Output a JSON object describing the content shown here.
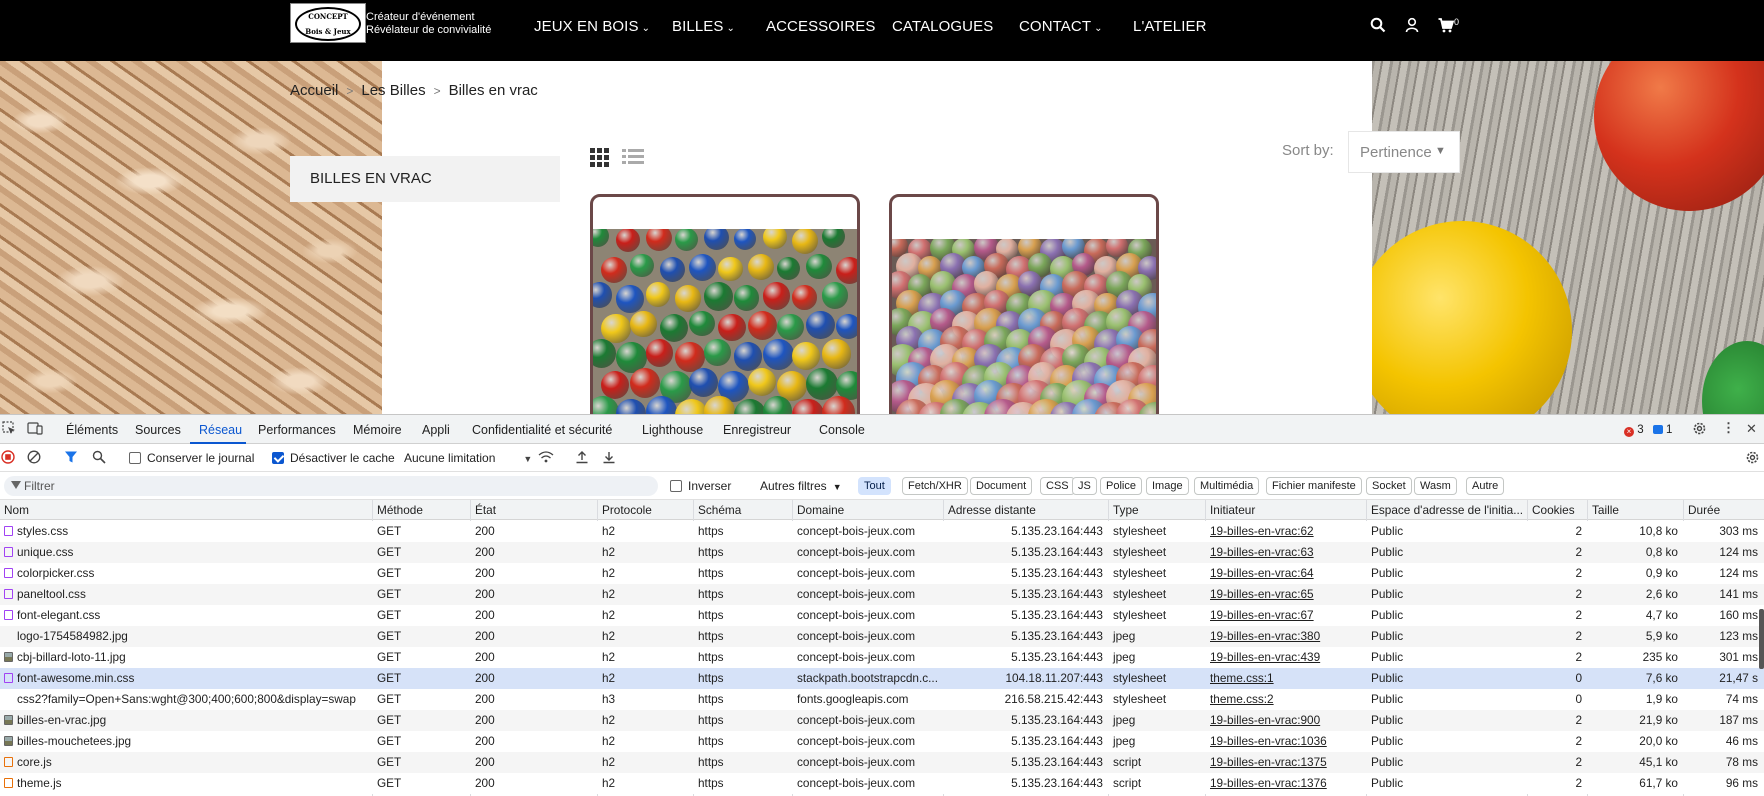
{
  "site": {
    "logo": {
      "line1": "CONCEPT",
      "line2": "Bois & Jeux"
    },
    "tagline": [
      "Créateur d'événement",
      "Révélateur de convivialité"
    ],
    "nav": [
      {
        "label": "JEUX EN BOIS",
        "has_caret": true
      },
      {
        "label": "BILLES",
        "has_caret": true
      },
      {
        "label": "ACCESSOIRES",
        "has_caret": false
      },
      {
        "label": "CATALOGUES",
        "has_caret": false
      },
      {
        "label": "CONTACT",
        "has_caret": true
      },
      {
        "label": "L'ATELIER",
        "has_caret": false
      }
    ],
    "icons": [
      "search-icon",
      "user-icon",
      "cart-icon"
    ],
    "cart_count": "0",
    "breadcrumb": [
      "Accueil",
      "Les Billes",
      "Billes en vrac"
    ],
    "sidebar_title": "BILLES EN VRAC",
    "sort_label": "Sort by:",
    "sort_value": "Pertinence",
    "colors": {
      "topbar": "#000000",
      "card_border": "#6b4848"
    }
  },
  "devtools": {
    "tabs": [
      "Éléments",
      "Sources",
      "Réseau",
      "Performances",
      "Mémoire",
      "Appli",
      "Confidentialité et sécurité",
      "Lighthouse",
      "Enregistreur",
      "Console"
    ],
    "active_tab": "Réseau",
    "error_count": "3",
    "message_count": "1",
    "toolbar": {
      "preserve_log": "Conserver le journal",
      "preserve_log_checked": false,
      "disable_cache": "Désactiver le cache",
      "disable_cache_checked": true,
      "throttling": "Aucune limitation"
    },
    "filter": {
      "placeholder": "Filtrer",
      "invert": "Inverser",
      "more_filters": "Autres filtres",
      "types": [
        "Tout",
        "Fetch/XHR",
        "Document",
        "CSS",
        "JS",
        "Police",
        "Image",
        "Multimédia",
        "Fichier manifeste",
        "Socket",
        "Wasm",
        "Autre"
      ],
      "active_type": "Tout"
    },
    "columns": [
      "Nom",
      "Méthode",
      "État",
      "Protocole",
      "Schéma",
      "Domaine",
      "Adresse distante",
      "Type",
      "Initiateur",
      "Espace d'adresse de l'initia...",
      "Cookies",
      "Taille",
      "Durée"
    ],
    "rows": [
      {
        "name": "styles.css",
        "icon": "css",
        "method": "GET",
        "status": "200",
        "protocol": "h2",
        "scheme": "https",
        "domain": "concept-bois-jeux.com",
        "remote": "5.135.23.164:443",
        "type": "stylesheet",
        "initiator": "19-billes-en-vrac:62",
        "space": "Public",
        "cookies": "2",
        "size": "10,8 ko",
        "time": "303 ms"
      },
      {
        "name": "unique.css",
        "icon": "css",
        "method": "GET",
        "status": "200",
        "protocol": "h2",
        "scheme": "https",
        "domain": "concept-bois-jeux.com",
        "remote": "5.135.23.164:443",
        "type": "stylesheet",
        "initiator": "19-billes-en-vrac:63",
        "space": "Public",
        "cookies": "2",
        "size": "0,8 ko",
        "time": "124 ms"
      },
      {
        "name": "colorpicker.css",
        "icon": "css",
        "method": "GET",
        "status": "200",
        "protocol": "h2",
        "scheme": "https",
        "domain": "concept-bois-jeux.com",
        "remote": "5.135.23.164:443",
        "type": "stylesheet",
        "initiator": "19-billes-en-vrac:64",
        "space": "Public",
        "cookies": "2",
        "size": "0,9 ko",
        "time": "124 ms"
      },
      {
        "name": "paneltool.css",
        "icon": "css",
        "method": "GET",
        "status": "200",
        "protocol": "h2",
        "scheme": "https",
        "domain": "concept-bois-jeux.com",
        "remote": "5.135.23.164:443",
        "type": "stylesheet",
        "initiator": "19-billes-en-vrac:65",
        "space": "Public",
        "cookies": "2",
        "size": "2,6 ko",
        "time": "141 ms"
      },
      {
        "name": "font-elegant.css",
        "icon": "css",
        "method": "GET",
        "status": "200",
        "protocol": "h2",
        "scheme": "https",
        "domain": "concept-bois-jeux.com",
        "remote": "5.135.23.164:443",
        "type": "stylesheet",
        "initiator": "19-billes-en-vrac:67",
        "space": "Public",
        "cookies": "2",
        "size": "4,7 ko",
        "time": "160 ms"
      },
      {
        "name": "logo-1754584982.jpg",
        "icon": "none",
        "method": "GET",
        "status": "200",
        "protocol": "h2",
        "scheme": "https",
        "domain": "concept-bois-jeux.com",
        "remote": "5.135.23.164:443",
        "type": "jpeg",
        "initiator": "19-billes-en-vrac:380",
        "space": "Public",
        "cookies": "2",
        "size": "5,9 ko",
        "time": "123 ms"
      },
      {
        "name": "cbj-billard-loto-11.jpg",
        "icon": "img",
        "method": "GET",
        "status": "200",
        "protocol": "h2",
        "scheme": "https",
        "domain": "concept-bois-jeux.com",
        "remote": "5.135.23.164:443",
        "type": "jpeg",
        "initiator": "19-billes-en-vrac:439",
        "space": "Public",
        "cookies": "2",
        "size": "235 ko",
        "time": "301 ms"
      },
      {
        "name": "font-awesome.min.css",
        "icon": "css",
        "method": "GET",
        "status": "200",
        "protocol": "h2",
        "scheme": "https",
        "domain": "stackpath.bootstrapcdn.c...",
        "remote": "104.18.11.207:443",
        "type": "stylesheet",
        "initiator": "theme.css:1",
        "space": "Public",
        "cookies": "0",
        "size": "7,6 ko",
        "time": "21,47 s",
        "selected": true
      },
      {
        "name": "css2?family=Open+Sans:wght@300;400;600;800&display=swap",
        "icon": "none",
        "method": "GET",
        "status": "200",
        "protocol": "h3",
        "scheme": "https",
        "domain": "fonts.googleapis.com",
        "remote": "216.58.215.42:443",
        "type": "stylesheet",
        "initiator": "theme.css:2",
        "space": "Public",
        "cookies": "0",
        "size": "1,9 ko",
        "time": "74 ms"
      },
      {
        "name": "billes-en-vrac.jpg",
        "icon": "img",
        "method": "GET",
        "status": "200",
        "protocol": "h2",
        "scheme": "https",
        "domain": "concept-bois-jeux.com",
        "remote": "5.135.23.164:443",
        "type": "jpeg",
        "initiator": "19-billes-en-vrac:900",
        "space": "Public",
        "cookies": "2",
        "size": "21,9 ko",
        "time": "187 ms"
      },
      {
        "name": "billes-mouchetees.jpg",
        "icon": "img",
        "method": "GET",
        "status": "200",
        "protocol": "h2",
        "scheme": "https",
        "domain": "concept-bois-jeux.com",
        "remote": "5.135.23.164:443",
        "type": "jpeg",
        "initiator": "19-billes-en-vrac:1036",
        "space": "Public",
        "cookies": "2",
        "size": "20,0 ko",
        "time": "46 ms"
      },
      {
        "name": "core.js",
        "icon": "js",
        "method": "GET",
        "status": "200",
        "protocol": "h2",
        "scheme": "https",
        "domain": "concept-bois-jeux.com",
        "remote": "5.135.23.164:443",
        "type": "script",
        "initiator": "19-billes-en-vrac:1375",
        "space": "Public",
        "cookies": "2",
        "size": "45,1 ko",
        "time": "78 ms"
      },
      {
        "name": "theme.js",
        "icon": "js",
        "method": "GET",
        "status": "200",
        "protocol": "h2",
        "scheme": "https",
        "domain": "concept-bois-jeux.com",
        "remote": "5.135.23.164:443",
        "type": "script",
        "initiator": "19-billes-en-vrac:1376",
        "space": "Public",
        "cookies": "2",
        "size": "61,7 ko",
        "time": "96 ms"
      }
    ]
  }
}
